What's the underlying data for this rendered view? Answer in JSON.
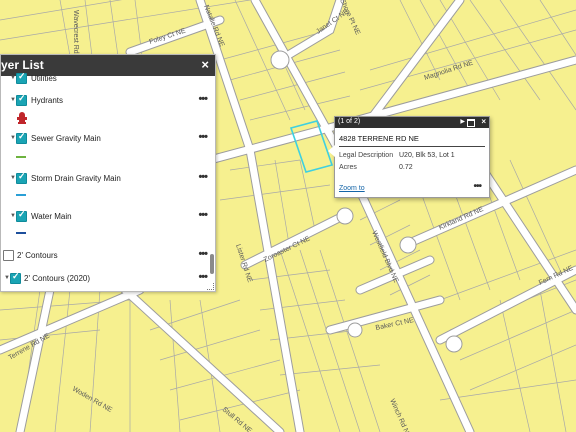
{
  "layer_list": {
    "title": "yer List",
    "close_glyph": "×",
    "more_glyph": "•••",
    "items": [
      {
        "label": "Utilities",
        "checked": true
      },
      {
        "label": "Hydrants",
        "checked": true,
        "symbol": "hydrant-icon",
        "symbol_color": "#c0262b"
      },
      {
        "label": "Sewer Gravity Main",
        "checked": true,
        "symbol_color": "#6db33f"
      },
      {
        "label": "Storm Drain Gravity Main",
        "checked": true,
        "symbol_color": "#2a9fd6"
      },
      {
        "label": "Water Main",
        "checked": true,
        "symbol_color": "#1d4f9c"
      },
      {
        "label": "2' Contours",
        "checked": false
      },
      {
        "label": "2' Contours (2020)",
        "checked": true
      }
    ]
  },
  "popup": {
    "count": "(1 of 2)",
    "next_glyph": "▶",
    "close_glyph": "×",
    "title": "4828 TERRENE RD NE",
    "fields": [
      {
        "name": "Legal Description",
        "value": "U20, Blk 53, Lot 1"
      },
      {
        "name": "Acres",
        "value": "0.72"
      }
    ],
    "zoom_label": "Zoom to",
    "more_glyph": "•••"
  },
  "map": {
    "parcel_color": "#f6f08f",
    "line_color": "#9d9d9d",
    "road_color": "#ffffff",
    "highlight_color": "#3fd0e0",
    "streets": [
      "Foley Ct NE",
      "Natalie Rd NE",
      "Janet Ct NE",
      "Magnolia Rd NE",
      "Terrene Rd NE",
      "Wavecrest Rd NE",
      "Kirkland Rd NE",
      "Fern Rd NE",
      "Zoroaster Ct NE",
      "Westfield Blvd NE",
      "Baker Ct NE",
      "Woden Rd NE",
      "Stull Rd NE",
      "Winch Rd NE",
      "Lister Rd NE",
      "Shore Pt NE"
    ]
  }
}
